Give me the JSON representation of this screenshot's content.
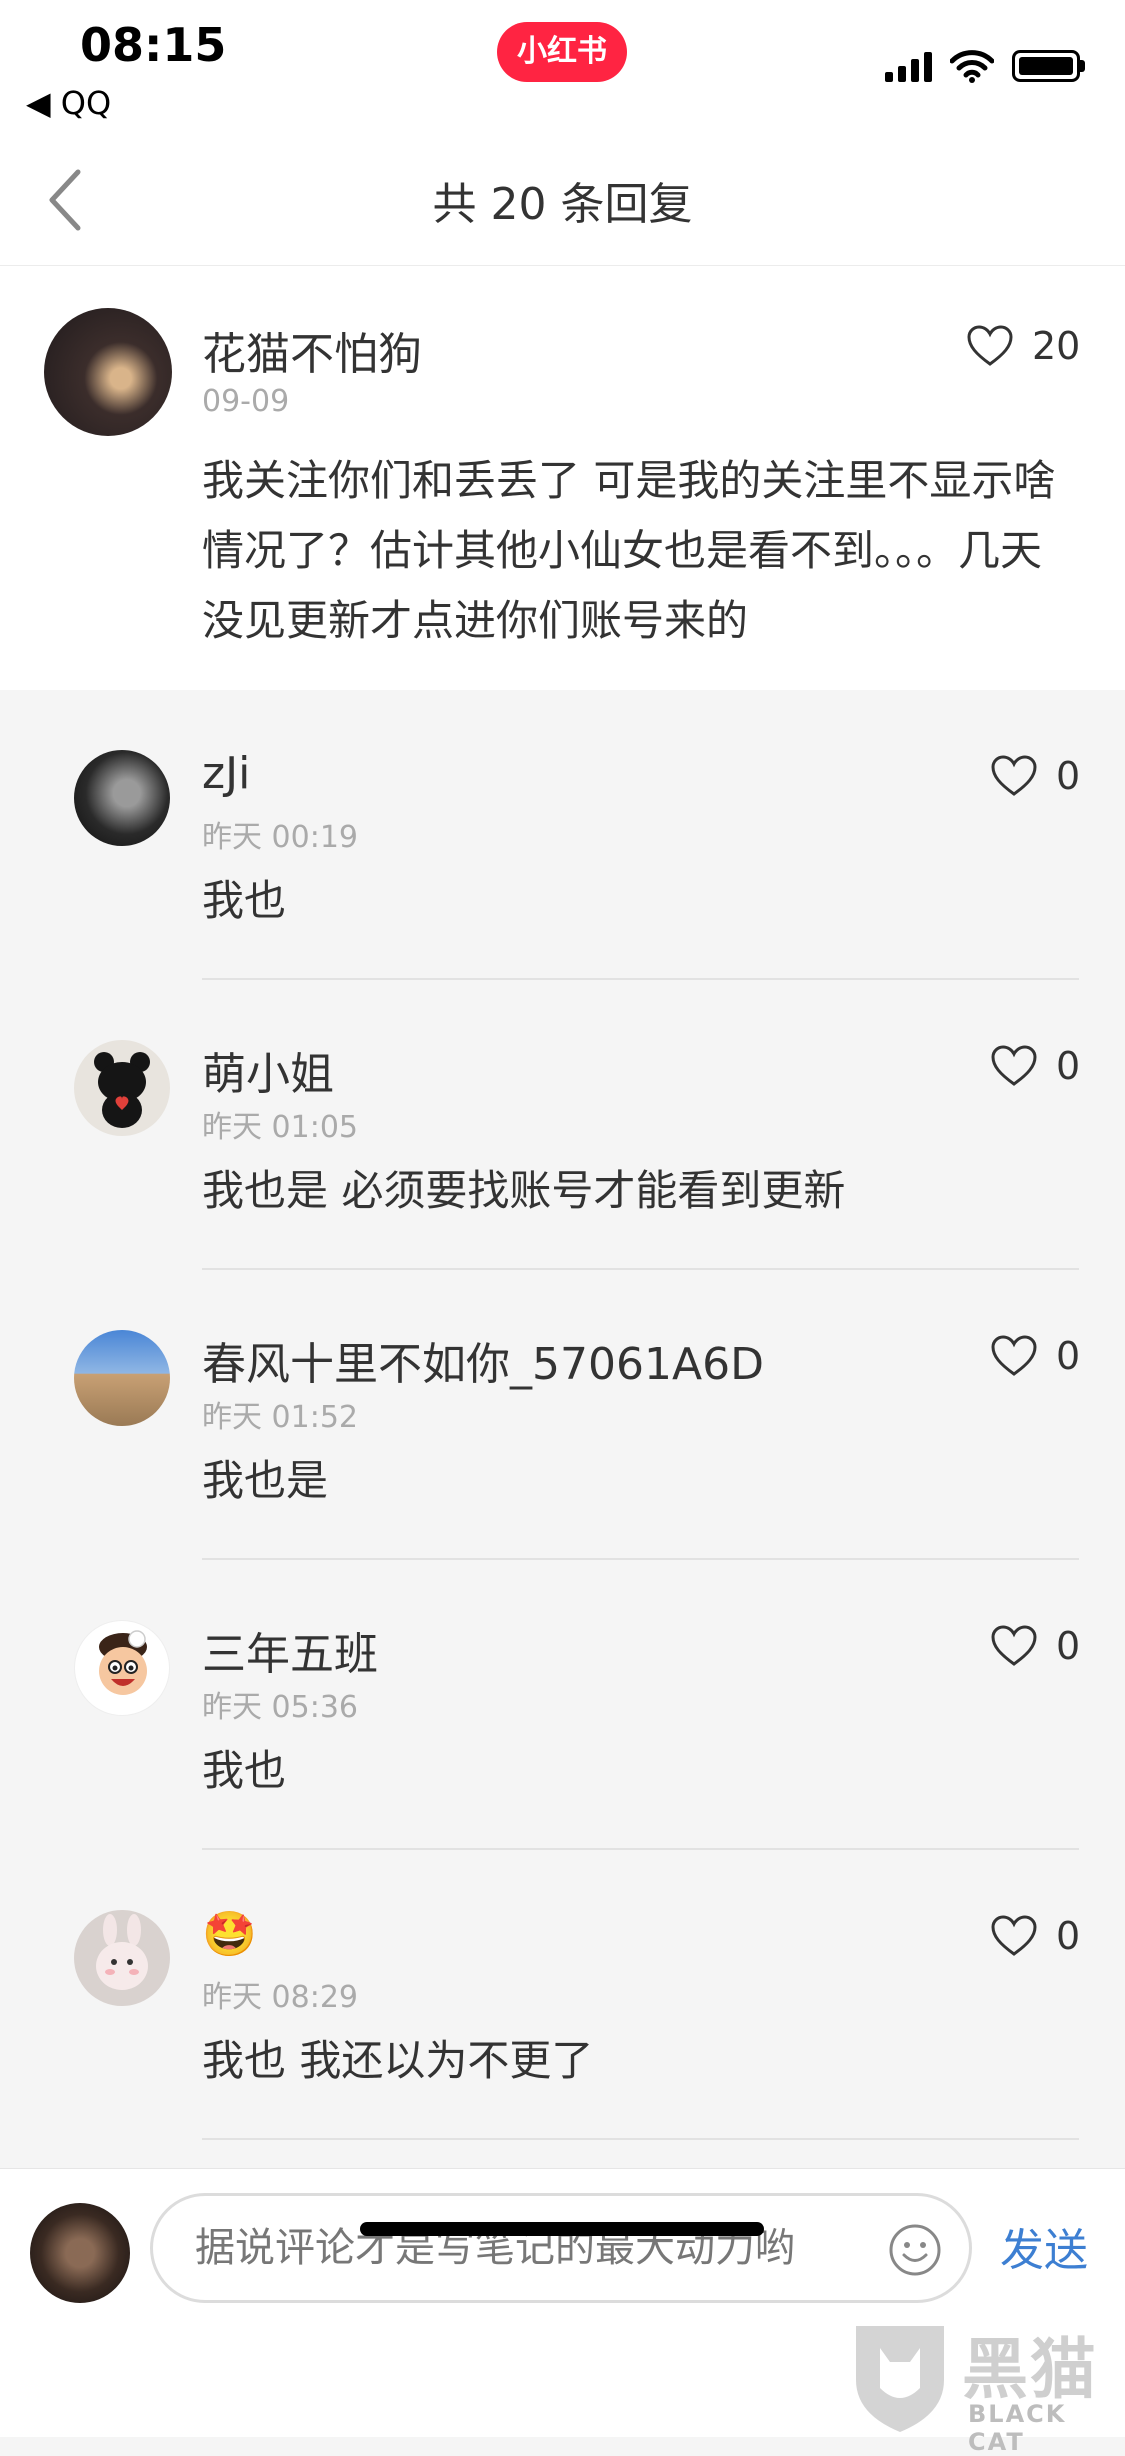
{
  "status_bar": {
    "time": "08:15",
    "back_app": "◀ QQ",
    "app_badge": "小红书"
  },
  "nav": {
    "title": "共 20 条回复"
  },
  "parent_comment": {
    "username": "花猫不怕狗",
    "date": "09-09",
    "text": "我关注你们和丢丢了 可是我的关注里不显示啥情况了？估计其他小仙女也是看不到。。。几天没见更新才点进你们账号来的",
    "likes": "20"
  },
  "replies": [
    {
      "username": "zJi",
      "date": "昨天 00:19",
      "text": "我也",
      "likes": "0"
    },
    {
      "username": "萌小姐",
      "date": "昨天 01:05",
      "text": "我也是 必须要找账号才能看到更新",
      "likes": "0"
    },
    {
      "username": "春风十里不如你_57061A6D",
      "date": "昨天 01:52",
      "text": "我也是",
      "likes": "0"
    },
    {
      "username": "三年五班",
      "date": "昨天 05:36",
      "text": "我也",
      "likes": "0"
    },
    {
      "username": "🤩",
      "date": "昨天 08:29",
      "text": "我也 我还以为不更了",
      "likes": "0"
    }
  ],
  "bottom_bar": {
    "input_placeholder": "据说评论才是写笔记的最大动力哟",
    "send_label": "发送"
  },
  "watermark": {
    "cn": "黑猫",
    "en": "BLACK CAT"
  },
  "colors": {
    "brand_red": "#ff2442",
    "send_blue": "#3d7fd2"
  },
  "icons": [
    "back-chevron-icon",
    "heart-outline-icon",
    "smiley-icon",
    "signal-icon",
    "wifi-icon",
    "battery-icon"
  ]
}
